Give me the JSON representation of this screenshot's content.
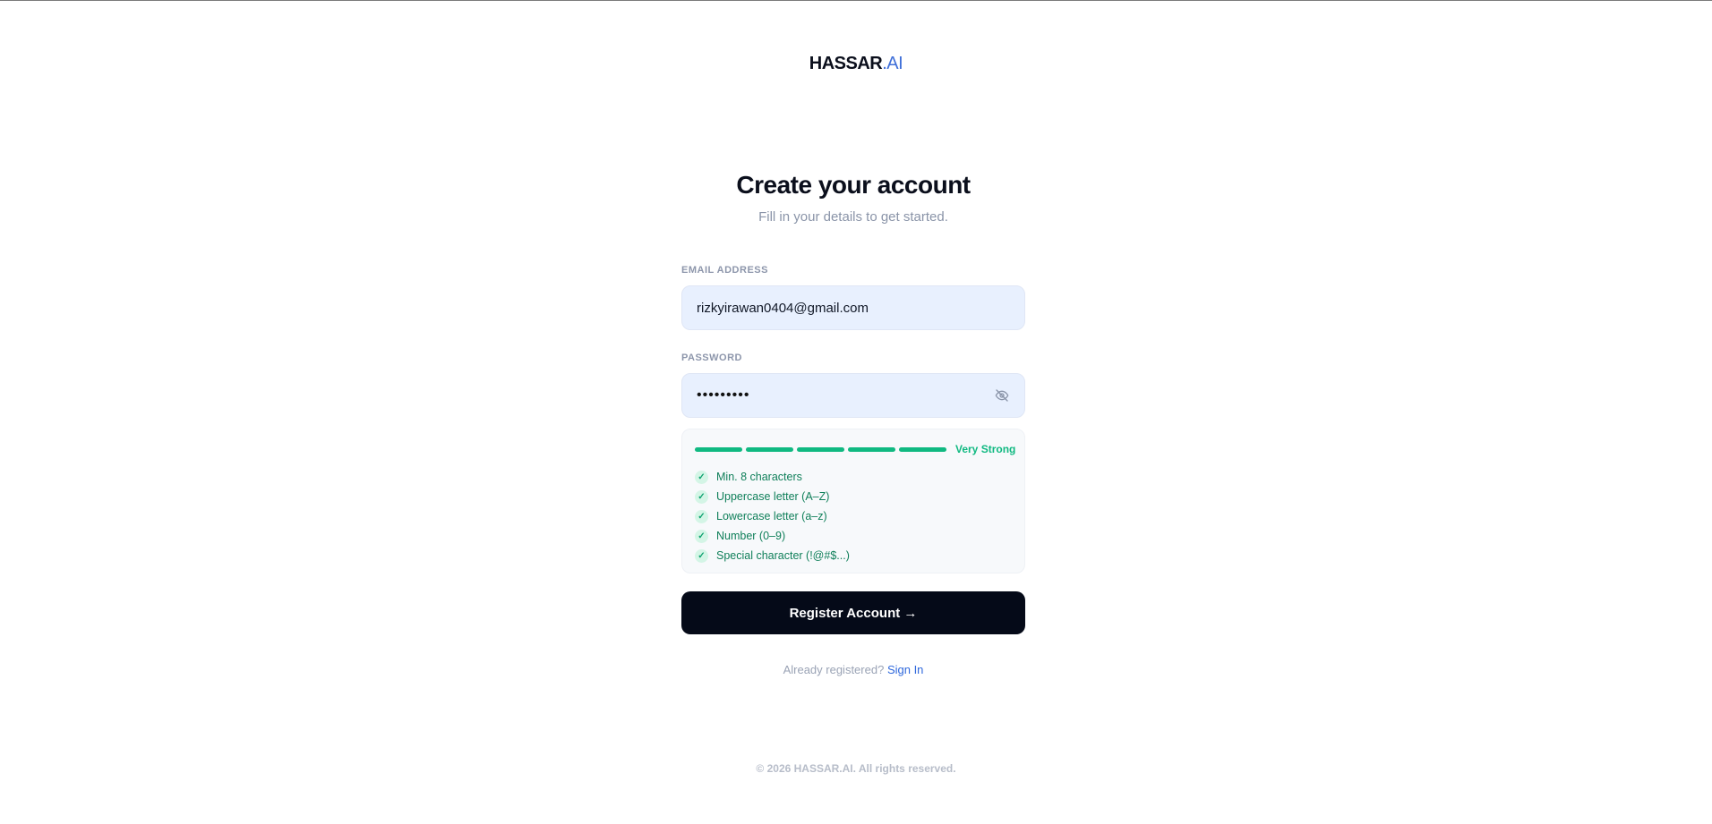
{
  "brand": {
    "name": "HASSAR",
    "tld": ".AI"
  },
  "header": {
    "title": "Create your account",
    "subtitle": "Fill in your details to get started."
  },
  "form": {
    "email_label": "EMAIL ADDRESS",
    "email_value": "rizkyirawan0404@gmail.com",
    "password_label": "PASSWORD",
    "password_masked": "•••••••••",
    "password_visibility_icon": "eye-off-icon",
    "strength": {
      "label": "Very Strong",
      "segments_filled": 5,
      "segments_total": 5,
      "color": "#10b981"
    },
    "requirements": [
      {
        "text": "Min. 8 characters",
        "met": true
      },
      {
        "text": "Uppercase letter (A–Z)",
        "met": true
      },
      {
        "text": "Lowercase letter (a–z)",
        "met": true
      },
      {
        "text": "Number (0–9)",
        "met": true
      },
      {
        "text": "Special character (!@#$...)",
        "met": true
      }
    ],
    "submit_label": "Register Account →"
  },
  "signin": {
    "prompt": "Already registered?",
    "link": "Sign In"
  },
  "footer": {
    "copyright": "© 2026 HASSAR.AI. All rights reserved."
  }
}
